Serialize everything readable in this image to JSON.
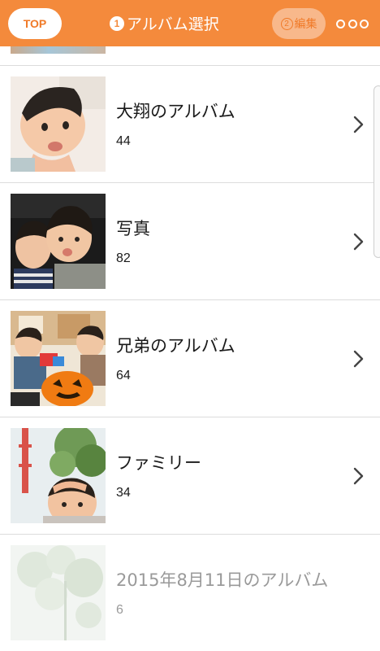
{
  "header": {
    "top_label": "TOP",
    "step_number": "1",
    "title": "アルバム選択",
    "edit_step_number": "2",
    "edit_label": "編集",
    "more_icon": "more-dots-icon"
  },
  "colors": {
    "header_bg": "#f48a3c",
    "accent": "#f07a28",
    "divider": "#dcdcdc",
    "disabled_text": "#9a9a9a"
  },
  "albums": [
    {
      "name": "大翔のアルバム",
      "count": "44"
    },
    {
      "name": "写真",
      "count": "82"
    },
    {
      "name": "兄弟のアルバム",
      "count": "64"
    },
    {
      "name": "ファミリー",
      "count": "34"
    },
    {
      "name": "2015年8月11日のアルバム",
      "count": "6",
      "disabled": true
    }
  ]
}
